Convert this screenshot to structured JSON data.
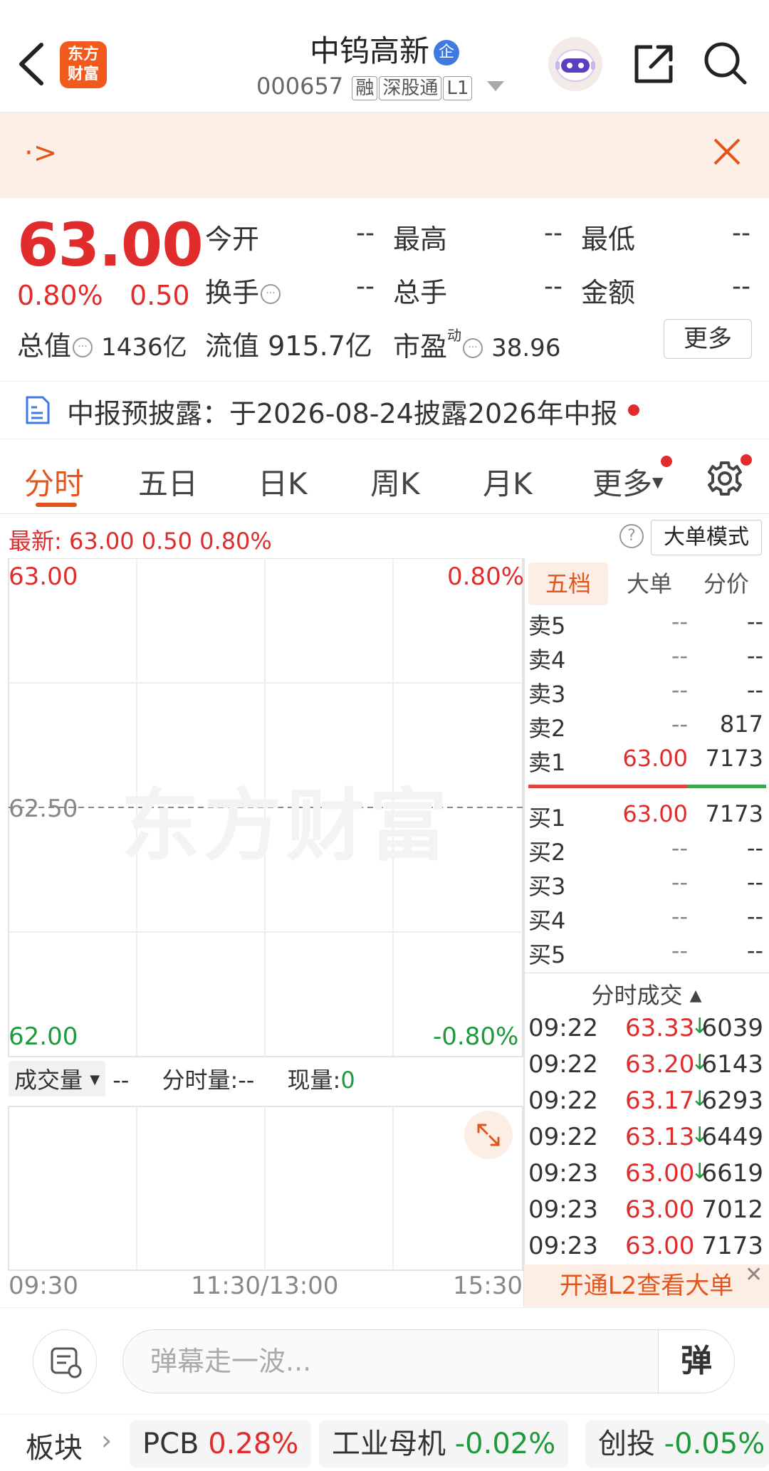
{
  "header": {
    "logo_text_1": "东方",
    "logo_text_2": "财富",
    "stock_name": "中钨高新",
    "badge": "企",
    "stock_code": "000657",
    "tags": [
      "融",
      "深股通",
      "L1"
    ]
  },
  "banner": {
    "arrow": "·>"
  },
  "quote": {
    "price": "63.00",
    "change_pct": "0.80%",
    "change": "0.50",
    "fields": [
      {
        "label": "今开",
        "value": "--"
      },
      {
        "label": "最高",
        "value": "--"
      },
      {
        "label": "最低",
        "value": "--"
      },
      {
        "label": "换手",
        "value": "--"
      },
      {
        "label": "总手",
        "value": "--"
      },
      {
        "label": "金额",
        "value": "--"
      }
    ],
    "total_value_label": "总值",
    "total_value": "1436亿",
    "float_value_label": "流值",
    "float_value": "915.7亿",
    "pe_label": "市盈",
    "pe_sup": "动",
    "pe_value": "38.96",
    "more": "更多"
  },
  "report": {
    "text": "中报预披露：于2026-08-24披露2026年中报"
  },
  "tabs": [
    "分时",
    "五日",
    "日K",
    "周K",
    "月K",
    "更多"
  ],
  "latest": {
    "text": "最新:  63.00   0.50   0.80%",
    "big_order_mode": "大单模式",
    "help": "?"
  },
  "chart_data": {
    "type": "line",
    "title": "",
    "y_left_ticks": [
      "63.00",
      "62.50",
      "62.00"
    ],
    "y_right_ticks": [
      "0.80%",
      "-0.80%"
    ],
    "x_ticks": [
      "09:30",
      "11:30/13:00",
      "15:30"
    ],
    "ylim": [
      62.0,
      63.0
    ],
    "reference_price": 62.5,
    "series": [],
    "grid": true
  },
  "watermark": "东方财富",
  "volume": {
    "selector": "成交量",
    "value": "--",
    "period_label": "分时量:--",
    "current_label": "现量:",
    "current_value": "0"
  },
  "orderbook": {
    "tabs": [
      "五档",
      "大单",
      "分价"
    ],
    "asks": [
      {
        "label": "卖5",
        "price": "--",
        "vol": "--"
      },
      {
        "label": "卖4",
        "price": "--",
        "vol": "--"
      },
      {
        "label": "卖3",
        "price": "--",
        "vol": "--"
      },
      {
        "label": "卖2",
        "price": "--",
        "vol": "817"
      },
      {
        "label": "卖1",
        "price": "63.00",
        "vol": "7173"
      }
    ],
    "bids": [
      {
        "label": "买1",
        "price": "63.00",
        "vol": "7173"
      },
      {
        "label": "买2",
        "price": "--",
        "vol": "--"
      },
      {
        "label": "买3",
        "price": "--",
        "vol": "--"
      },
      {
        "label": "买4",
        "price": "--",
        "vol": "--"
      },
      {
        "label": "买5",
        "price": "--",
        "vol": "--"
      }
    ]
  },
  "ticks": {
    "title": "分时成交",
    "rows": [
      {
        "time": "09:22",
        "price": "63.33",
        "arrow": "↓",
        "vol": "6039"
      },
      {
        "time": "09:22",
        "price": "63.20",
        "arrow": "↓",
        "vol": "6143"
      },
      {
        "time": "09:22",
        "price": "63.17",
        "arrow": "↓",
        "vol": "6293"
      },
      {
        "time": "09:22",
        "price": "63.13",
        "arrow": "↓",
        "vol": "6449"
      },
      {
        "time": "09:23",
        "price": "63.00",
        "arrow": "↓",
        "vol": "6619"
      },
      {
        "time": "09:23",
        "price": "63.00",
        "arrow": "",
        "vol": "7012"
      },
      {
        "time": "09:23",
        "price": "63.00",
        "arrow": "",
        "vol": "7173"
      }
    ],
    "l2_button": "开通L2查看大单"
  },
  "comment": {
    "placeholder": "弹幕走一波...",
    "send": "弹"
  },
  "sectors": {
    "label": "板块",
    "items": [
      {
        "name": "PCB",
        "pct": "0.28%",
        "dir": "up"
      },
      {
        "name": "工业母机",
        "pct": "-0.02%",
        "dir": "down"
      },
      {
        "name": "创投",
        "pct": "-0.05%",
        "dir": "down"
      }
    ]
  },
  "colors": {
    "up": "#e02c2c",
    "down": "#1d9a3c",
    "accent": "#e2561d"
  }
}
